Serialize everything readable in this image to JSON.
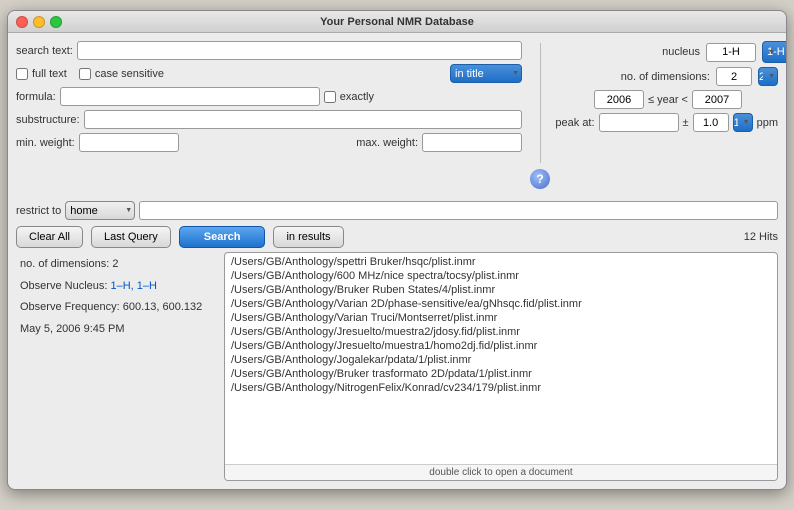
{
  "window": {
    "title": "Your Personal NMR Database"
  },
  "search": {
    "search_text_label": "search text:",
    "full_text_label": "full text",
    "case_sensitive_label": "case sensitive",
    "in_title_option": "in title",
    "formula_label": "formula:",
    "exactly_label": "exactly",
    "substructure_label": "substructure:",
    "min_weight_label": "min. weight:",
    "max_weight_label": "max. weight:",
    "restrict_label": "restrict to",
    "restrict_value": "home",
    "clear_button": "Clear All",
    "last_query_button": "Last Query",
    "search_button": "Search",
    "in_results_button": "in results",
    "hits_text": "12 Hits"
  },
  "nucleus": {
    "label": "nucleus",
    "value1": "1-H",
    "value2": "1-H"
  },
  "dimensions": {
    "label": "no. of dimensions:",
    "value": "2"
  },
  "year": {
    "from": "2006",
    "lte": "≤ year <",
    "to": "2007"
  },
  "peak": {
    "label": "peak at:",
    "plusminus": "±",
    "value": "1.0",
    "unit": "ppm"
  },
  "info": {
    "dimensions": "no. of dimensions: 2",
    "nucleus": "Observe Nucleus:",
    "nucleus_values": "1–H, 1–H",
    "frequency": "Observe Frequency: 600.13, 600.132",
    "date": "May 5, 2006 9:45 PM"
  },
  "results": {
    "items": [
      "/Users/GB/Anthology/spettri Bruker/hsqc/plist.inmr",
      "/Users/GB/Anthology/600 MHz/nice spectra/tocsy/plist.inmr",
      "/Users/GB/Anthology/Bruker Ruben States/4/plist.inmr",
      "/Users/GB/Anthology/Varian 2D/phase-sensitive/ea/gNhsqc.fid/plist.inmr",
      "/Users/GB/Anthology/Varian Truci/Montserret/plist.inmr",
      "/Users/GB/Anthology/Jresuelto/muestra2/jdosy.fid/plist.inmr",
      "/Users/GB/Anthology/Jresuelto/muestra1/homo2dj.fid/plist.inmr",
      "/Users/GB/Anthology/Jogalekar/pdata/1/plist.inmr",
      "/Users/GB/Anthology/Bruker trasformato 2D/pdata/1/plist.inmr",
      "/Users/GB/Anthology/NitrogenFelix/Konrad/cv234/179/plist.inmr"
    ],
    "footer": "double click to open a document"
  }
}
